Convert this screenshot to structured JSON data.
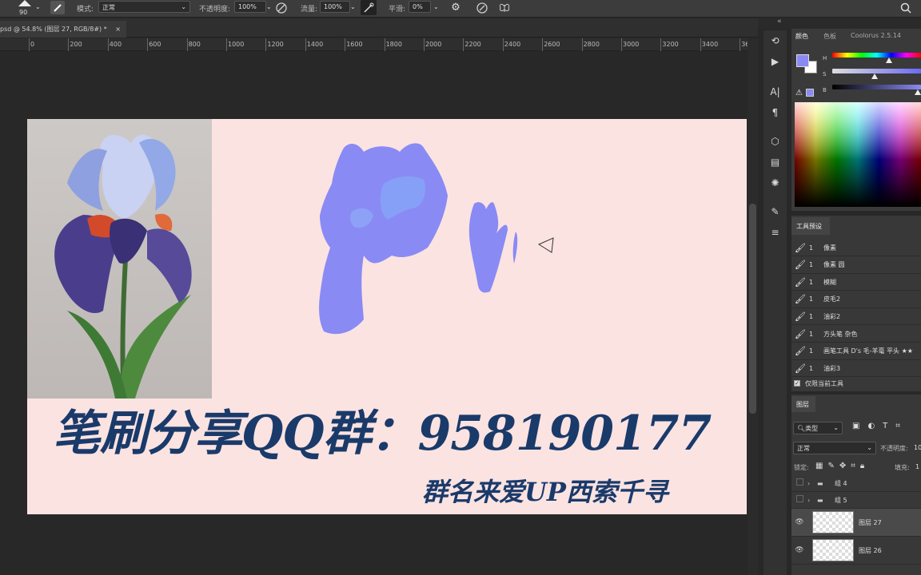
{
  "options_bar": {
    "brush_size": "90",
    "mode_label": "模式:",
    "mode_value": "正常",
    "opacity_label": "不透明度:",
    "opacity_value": "100%",
    "flow_label": "流量:",
    "flow_value": "100%",
    "smoothing_label": "平滑:",
    "smoothing_value": "0%"
  },
  "document_tab": {
    "title": "psd @ 54.8% (图层 27, RGB/8#) *",
    "close": "×"
  },
  "ruler": {
    "ticks": [
      "0",
      "200",
      "400",
      "600",
      "800",
      "1000",
      "1200",
      "1400",
      "1600",
      "1800",
      "2000",
      "2200",
      "2400",
      "2600",
      "2800",
      "3000",
      "3200",
      "3400",
      "36"
    ]
  },
  "canvas": {
    "handwritten_line1": "笔刷分享QQ群：958190177",
    "handwritten_line2": "群名来爱UP西索千寻",
    "shape_fill": "#8a8af5",
    "shape_highlight": "#86a0f7",
    "text_color": "#1a3a6a"
  },
  "color_panel": {
    "tabs": [
      "颜色",
      "色板",
      "Coolorus 2.5.14"
    ],
    "h_label": "H",
    "s_label": "S",
    "b_label": "B",
    "foreground": "#8a8af5"
  },
  "tool_presets": {
    "title": "工具预设",
    "items": [
      {
        "size": "1",
        "name": "像素"
      },
      {
        "size": "1",
        "name": "像素 圆"
      },
      {
        "size": "1",
        "name": "模糊"
      },
      {
        "size": "1",
        "name": "皮毛2"
      },
      {
        "size": "1",
        "name": "油彩2"
      },
      {
        "size": "1",
        "name": "方头笔 杂色"
      },
      {
        "size": "1",
        "name": "画笔工具 D's 毛-羊毫 平头 ★★"
      },
      {
        "size": "1",
        "name": "油彩3"
      }
    ],
    "current_only_label": "仅限当前工具"
  },
  "layers": {
    "title": "图层",
    "filter_label": "类型",
    "blend_mode": "正常",
    "opacity_label": "不透明度:",
    "opacity_value": "10",
    "lock_label": "锁定:",
    "fill_label": "填充:",
    "fill_value": "1",
    "items": [
      {
        "name": "组 4",
        "kind": "group"
      },
      {
        "name": "组 5",
        "kind": "group"
      },
      {
        "name": "图层 27",
        "kind": "layer"
      },
      {
        "name": "图层 26",
        "kind": "layer"
      }
    ]
  }
}
